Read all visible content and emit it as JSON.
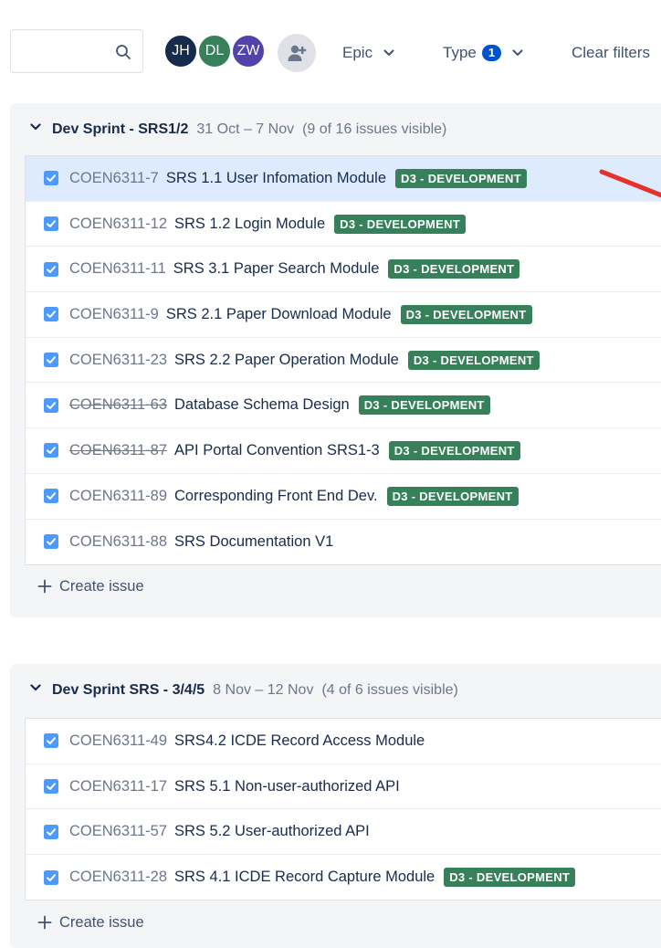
{
  "search": {
    "value": "",
    "placeholder": ""
  },
  "avatars": [
    {
      "initials": "JH",
      "color": "#172b4d"
    },
    {
      "initials": "DL",
      "color": "#36805a"
    },
    {
      "initials": "ZW",
      "color": "#5243aa"
    }
  ],
  "filters": {
    "epic_label": "Epic",
    "type_label": "Type",
    "type_count": "1",
    "clear_label": "Clear filters"
  },
  "sprints": [
    {
      "name": "Dev Sprint - SRS1/2",
      "dates": "31 Oct – 7 Nov",
      "count_text": "(9 of 16 issues visible)",
      "issues": [
        {
          "key": "COEN6311-7",
          "summary": "SRS 1.1 User Infomation Module",
          "label": "D3 - DEVELOPMENT",
          "done": false
        },
        {
          "key": "COEN6311-12",
          "summary": "SRS 1.2 Login Module",
          "label": "D3 - DEVELOPMENT",
          "done": false
        },
        {
          "key": "COEN6311-11",
          "summary": "SRS 3.1 Paper Search Module",
          "label": "D3 - DEVELOPMENT",
          "done": false
        },
        {
          "key": "COEN6311-9",
          "summary": "SRS 2.1 Paper Download Module",
          "label": "D3 - DEVELOPMENT",
          "done": false
        },
        {
          "key": "COEN6311-23",
          "summary": "SRS 2.2 Paper Operation Module",
          "label": "D3 - DEVELOPMENT",
          "done": false
        },
        {
          "key": "COEN6311-63",
          "summary": "Database Schema Design",
          "label": "D3 - DEVELOPMENT",
          "done": true
        },
        {
          "key": "COEN6311-87",
          "summary": "API Portal Convention SRS1-3",
          "label": "D3 - DEVELOPMENT",
          "done": true
        },
        {
          "key": "COEN6311-89",
          "summary": "Corresponding Front End Dev.",
          "label": "D3 - DEVELOPMENT",
          "done": false
        },
        {
          "key": "COEN6311-88",
          "summary": "SRS Documentation V1",
          "label": "",
          "done": false
        }
      ],
      "create_label": "Create issue"
    },
    {
      "name": "Dev Sprint SRS - 3/4/5",
      "dates": "8 Nov – 12 Nov",
      "count_text": "(4 of 6 issues visible)",
      "issues": [
        {
          "key": "COEN6311-49",
          "summary": "SRS4.2 ICDE Record Access Module",
          "label": "",
          "done": false
        },
        {
          "key": "COEN6311-17",
          "summary": "SRS 5.1 Non-user-authorized API",
          "label": "",
          "done": false
        },
        {
          "key": "COEN6311-57",
          "summary": "SRS 5.2 User-authorized API",
          "label": "",
          "done": false
        },
        {
          "key": "COEN6311-28",
          "summary": "SRS 4.1 ICDE Record Capture Module",
          "label": "D3 - DEVELOPMENT",
          "done": false
        }
      ],
      "create_label": "Create issue"
    }
  ],
  "colors": {
    "label_bg": "#36805a",
    "selected_row": "#deebff",
    "checkbox": "#4c9aff",
    "annotation": "#e5322d"
  }
}
